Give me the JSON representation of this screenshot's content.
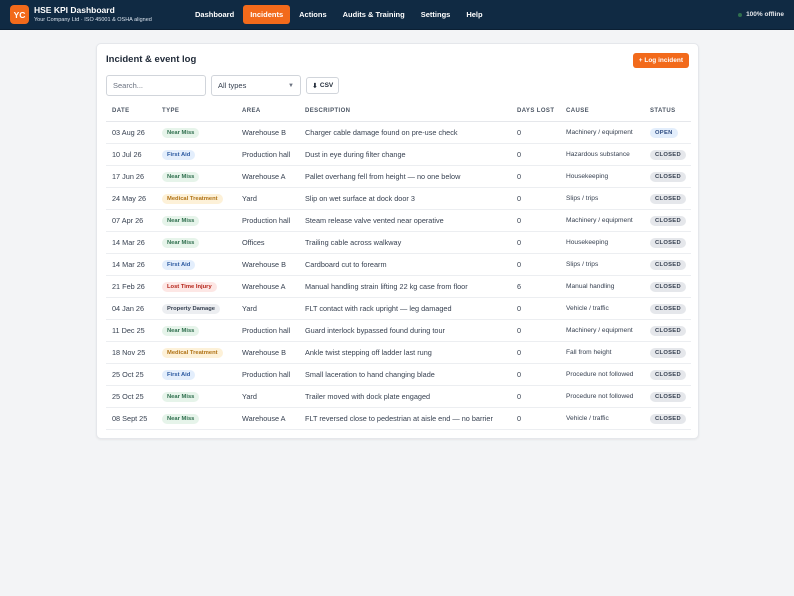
{
  "app": {
    "logo": "YC",
    "title": "HSE KPI Dashboard",
    "subtitle": "Your Company Ltd · ISO 45001 & OSHA aligned"
  },
  "nav": {
    "items": [
      "Dashboard",
      "Incidents",
      "Actions",
      "Audits & Training",
      "Settings",
      "Help"
    ],
    "active": "Incidents"
  },
  "status": {
    "label": "100% offline"
  },
  "card": {
    "title": "Incident & event log",
    "log_button": "+ Log incident"
  },
  "controls": {
    "search_placeholder": "Search...",
    "type_filter": "All types",
    "csv_label": "CSV"
  },
  "table": {
    "headers": [
      "DATE",
      "TYPE",
      "AREA",
      "DESCRIPTION",
      "DAYS LOST",
      "CAUSE",
      "STATUS"
    ],
    "rows": [
      {
        "date": "03 Aug 26",
        "type": "Near Miss",
        "area": "Warehouse B",
        "description": "Charger cable damage found on pre-use check",
        "days": "0",
        "cause": "Machinery / equipment",
        "status": "OPEN"
      },
      {
        "date": "10 Jul 26",
        "type": "First Aid",
        "area": "Production hall",
        "description": "Dust in eye during filter change",
        "days": "0",
        "cause": "Hazardous substance",
        "status": "CLOSED"
      },
      {
        "date": "17 Jun 26",
        "type": "Near Miss",
        "area": "Warehouse A",
        "description": "Pallet overhang fell from height — no one below",
        "days": "0",
        "cause": "Housekeeping",
        "status": "CLOSED"
      },
      {
        "date": "24 May 26",
        "type": "Medical Treatment",
        "area": "Yard",
        "description": "Slip on wet surface at dock door 3",
        "days": "0",
        "cause": "Slips / trips",
        "status": "CLOSED"
      },
      {
        "date": "07 Apr 26",
        "type": "Near Miss",
        "area": "Production hall",
        "description": "Steam release valve vented near operative",
        "days": "0",
        "cause": "Machinery / equipment",
        "status": "CLOSED"
      },
      {
        "date": "14 Mar 26",
        "type": "Near Miss",
        "area": "Offices",
        "description": "Trailing cable across walkway",
        "days": "0",
        "cause": "Housekeeping",
        "status": "CLOSED"
      },
      {
        "date": "14 Mar 26",
        "type": "First Aid",
        "area": "Warehouse B",
        "description": "Cardboard cut to forearm",
        "days": "0",
        "cause": "Slips / trips",
        "status": "CLOSED"
      },
      {
        "date": "21 Feb 26",
        "type": "Lost Time Injury",
        "area": "Warehouse A",
        "description": "Manual handling strain lifting 22 kg case from floor",
        "days": "6",
        "cause": "Manual handling",
        "status": "CLOSED"
      },
      {
        "date": "04 Jan 26",
        "type": "Property Damage",
        "area": "Yard",
        "description": "FLT contact with rack upright — leg damaged",
        "days": "0",
        "cause": "Vehicle / traffic",
        "status": "CLOSED"
      },
      {
        "date": "11 Dec 25",
        "type": "Near Miss",
        "area": "Production hall",
        "description": "Guard interlock bypassed found during tour",
        "days": "0",
        "cause": "Machinery / equipment",
        "status": "CLOSED"
      },
      {
        "date": "18 Nov 25",
        "type": "Medical Treatment",
        "area": "Warehouse B",
        "description": "Ankle twist stepping off ladder last rung",
        "days": "0",
        "cause": "Fall from height",
        "status": "CLOSED"
      },
      {
        "date": "25 Oct 25",
        "type": "First Aid",
        "area": "Production hall",
        "description": "Small laceration to hand changing blade",
        "days": "0",
        "cause": "Procedure not followed",
        "status": "CLOSED"
      },
      {
        "date": "25 Oct 25",
        "type": "Near Miss",
        "area": "Yard",
        "description": "Trailer moved with dock plate engaged",
        "days": "0",
        "cause": "Procedure not followed",
        "status": "CLOSED"
      },
      {
        "date": "08 Sept 25",
        "type": "Near Miss",
        "area": "Warehouse A",
        "description": "FLT reversed close to pedestrian at aisle end — no barrier",
        "days": "0",
        "cause": "Vehicle / traffic",
        "status": "CLOSED"
      }
    ]
  },
  "colors": {
    "topbar": "#102a43",
    "accent": "#f26a1b",
    "near_miss": "#2f6f4e",
    "first_aid": "#2c5aa0",
    "medical_treatment": "#b07215",
    "lost_time_injury": "#b42318"
  }
}
